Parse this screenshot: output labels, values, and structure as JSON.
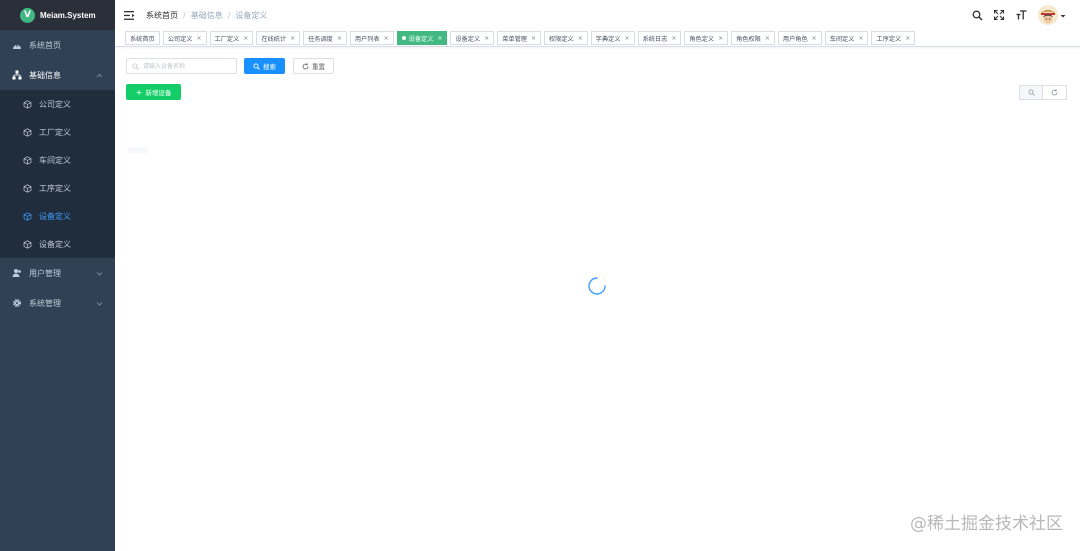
{
  "app": {
    "logo_letter": "V",
    "title": "Meiam.System"
  },
  "sidebar": {
    "items": [
      {
        "label": "系统首页",
        "icon": "dashboard-icon"
      },
      {
        "label": "基础信息",
        "icon": "tree-icon",
        "expanded": true,
        "children": [
          {
            "label": "公司定义",
            "icon": "cube-icon",
            "active": false
          },
          {
            "label": "工厂定义",
            "icon": "cube-icon",
            "active": false
          },
          {
            "label": "车间定义",
            "icon": "cube-icon",
            "active": false
          },
          {
            "label": "工序定义",
            "icon": "cube-icon",
            "active": false
          },
          {
            "label": "设备定义",
            "icon": "cube-icon",
            "active": true
          },
          {
            "label": "设备定义",
            "icon": "cube-icon",
            "active": false
          }
        ]
      },
      {
        "label": "用户管理",
        "icon": "user-icon",
        "expanded": false
      },
      {
        "label": "系统管理",
        "icon": "gear-icon",
        "expanded": false
      }
    ]
  },
  "header": {
    "breadcrumb": [
      "系统首页",
      "基础信息",
      "设备定义"
    ],
    "icons": [
      "search-icon",
      "fullscreen-icon",
      "font-size-icon"
    ]
  },
  "tags": [
    {
      "label": "系统首页",
      "closable": false,
      "active": false
    },
    {
      "label": "公司定义",
      "closable": true,
      "active": false
    },
    {
      "label": "工厂定义",
      "closable": true,
      "active": false
    },
    {
      "label": "在线统计",
      "closable": true,
      "active": false
    },
    {
      "label": "任务调度",
      "closable": true,
      "active": false
    },
    {
      "label": "用户列表",
      "closable": true,
      "active": false
    },
    {
      "label": "设备定义",
      "closable": true,
      "active": true
    },
    {
      "label": "设备定义",
      "closable": true,
      "active": false
    },
    {
      "label": "菜单管理",
      "closable": true,
      "active": false
    },
    {
      "label": "权限定义",
      "closable": true,
      "active": false
    },
    {
      "label": "字典定义",
      "closable": true,
      "active": false
    },
    {
      "label": "系统日志",
      "closable": true,
      "active": false
    },
    {
      "label": "角色定义",
      "closable": true,
      "active": false
    },
    {
      "label": "角色权限",
      "closable": true,
      "active": false
    },
    {
      "label": "用户角色",
      "closable": true,
      "active": false
    },
    {
      "label": "车间定义",
      "closable": true,
      "active": false
    },
    {
      "label": "工序定义",
      "closable": true,
      "active": false
    }
  ],
  "main": {
    "search_placeholder": "请输入设备名称",
    "search_button": "搜索",
    "reset_button": "重置",
    "add_button": "新增设备",
    "toolbar_icons": [
      "search-toggle-icon",
      "refresh-icon"
    ]
  },
  "watermark": "@稀土掘金技术社区",
  "colors": {
    "sidebar_bg": "#304156",
    "submenu_bg": "#1f2d3d",
    "active_menu": "#409eff",
    "active_tag": "#42b983",
    "primary": "#1890ff",
    "success": "#13ce66"
  }
}
